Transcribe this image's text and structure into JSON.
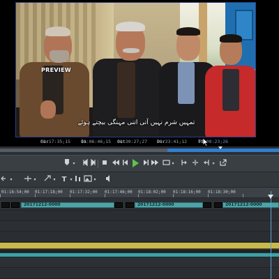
{
  "preview": {
    "label": "PREVIEW",
    "subtitle": "تمہیں شرم نہیں آتی اتنی مہنگی بیچتے ہوئے"
  },
  "timecodes": {
    "cur_key": "Cur",
    "cur_val": "01:17:35;15",
    "in_key": "In",
    "in_val": "01:06:46;15",
    "out_key": "Out",
    "out_val": "01:30:27;27",
    "dur_key": "Dur",
    "dur_val": "00:23:41;12",
    "ttl_key": "Ttl",
    "ttl_val": "01:00:23;26"
  },
  "toolbar": {
    "icons": [
      "marker-icon",
      "marker-dropdown-icon",
      "set-in-icon",
      "set-out-icon",
      "stop-icon",
      "step-back-icon",
      "frame-back-icon",
      "play-icon",
      "frame-forward-icon",
      "fast-forward-icon",
      "loop-icon",
      "match-frame-icon",
      "split-icon",
      "trim-icon",
      "export-icon"
    ]
  },
  "ruler": {
    "labels": [
      "01:16:54;00",
      "01:17:18;00",
      "01:17:32;00",
      "01:17:46;00",
      "01:18:02;00",
      "01:18:16;00",
      "01:18:30;00"
    ]
  },
  "timeline": {
    "clips": [
      {
        "label": "20171212-0000"
      },
      {
        "label": "20171212-0000"
      },
      {
        "label": "20171212-0000"
      }
    ]
  },
  "colors": {
    "clip": "#4fa3a8",
    "audio_track": "#c9b94a",
    "audio_track_2": "#3aa3a8",
    "scrub_range": "#2f7fd0",
    "playhead": "#5fa9d9"
  }
}
